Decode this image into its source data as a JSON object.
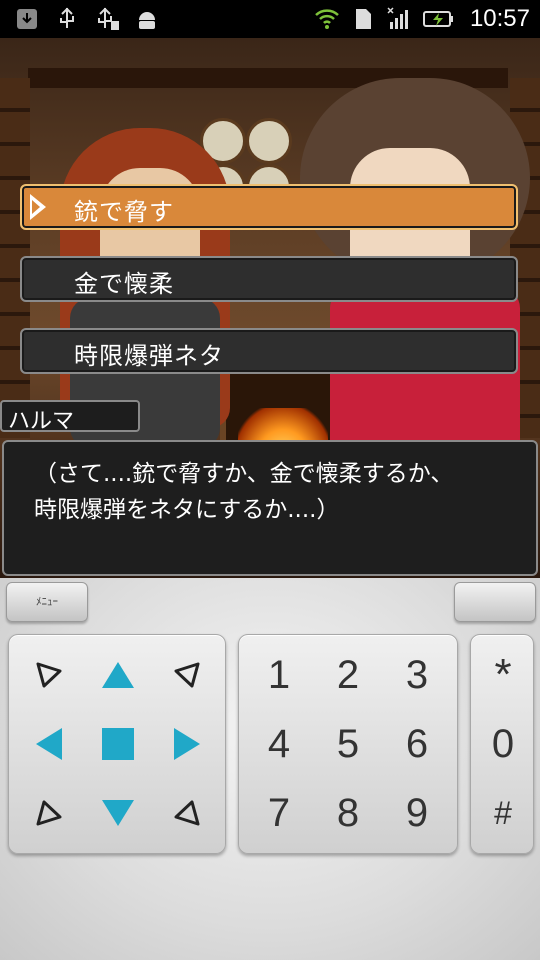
{
  "status_bar": {
    "time": "10:57",
    "left_icons": [
      "download-icon",
      "usb-icon",
      "usb-debug-icon",
      "android-icon"
    ],
    "right_icons": [
      "wifi-icon",
      "sd-card-icon",
      "signal-icon",
      "battery-charging-icon"
    ]
  },
  "game": {
    "choices": [
      {
        "label": "銃で脅す",
        "selected": true
      },
      {
        "label": "金で懐柔",
        "selected": false
      },
      {
        "label": "時限爆弾ネタ",
        "selected": false
      }
    ],
    "speaker": "ハルマ",
    "message": "（さて....銃で脅すか、金で懐柔するか、\n時限爆弾をネタにするか....）"
  },
  "controls": {
    "menu_label": "ﾒﾆｭｰ",
    "right_button_label": "",
    "dpad": [
      "up-left",
      "up",
      "up-right",
      "left",
      "center",
      "right",
      "down-left",
      "down",
      "down-right"
    ],
    "numpad": [
      "1",
      "2",
      "3",
      "4",
      "5",
      "6",
      "7",
      "8",
      "9"
    ],
    "side_keys": [
      "*",
      "0",
      "#"
    ]
  },
  "colors": {
    "accent_blue": "#20a8c8",
    "selected_choice": "#d9883a"
  }
}
